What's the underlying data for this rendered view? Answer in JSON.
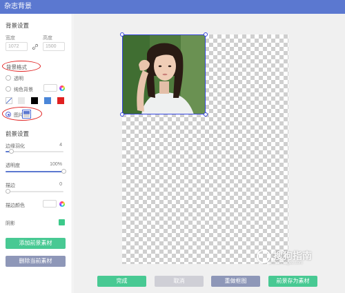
{
  "app": {
    "title": "杂志背景"
  },
  "background": {
    "section_title": "背景设置",
    "width_label": "宽度",
    "height_label": "高度",
    "width_value": "1072",
    "height_value": "1500",
    "style_title": "背景格式",
    "option_transparent": "透明",
    "option_solid": "纯色背景",
    "option_image": "图片",
    "selected_option": "图片",
    "swatches": [
      "#000000",
      "#ffffff",
      "#4a86d8",
      "#e02020"
    ]
  },
  "foreground": {
    "section_title": "前景设置",
    "feather_label": "边缘羽化",
    "feather_value": "4",
    "feather_level": 0.1,
    "opacity_label": "透明度",
    "opacity_value": "100%",
    "opacity_level": 1.0,
    "stroke_label": "描边",
    "stroke_value": "0",
    "stroke_level": 0,
    "stroke_color_label": "描边颜色",
    "shadow_label": "阴影",
    "shadow_color": "#3cc98a"
  },
  "side_buttons": {
    "add_label": "添加前景素材",
    "delete_label": "删除当前素材"
  },
  "bottom_buttons": {
    "done": "完成",
    "cancel": "取消",
    "reset": "重做框图",
    "save": "前景存为素材"
  },
  "watermark": {
    "brand": "搜狗指南",
    "url": "zhinan.sogou.com"
  },
  "colors": {
    "primary": "#5b78d0",
    "green": "#48c993",
    "gray": "#cfcfd6",
    "slate": "#8e97b8",
    "annotation": "#e02020"
  }
}
